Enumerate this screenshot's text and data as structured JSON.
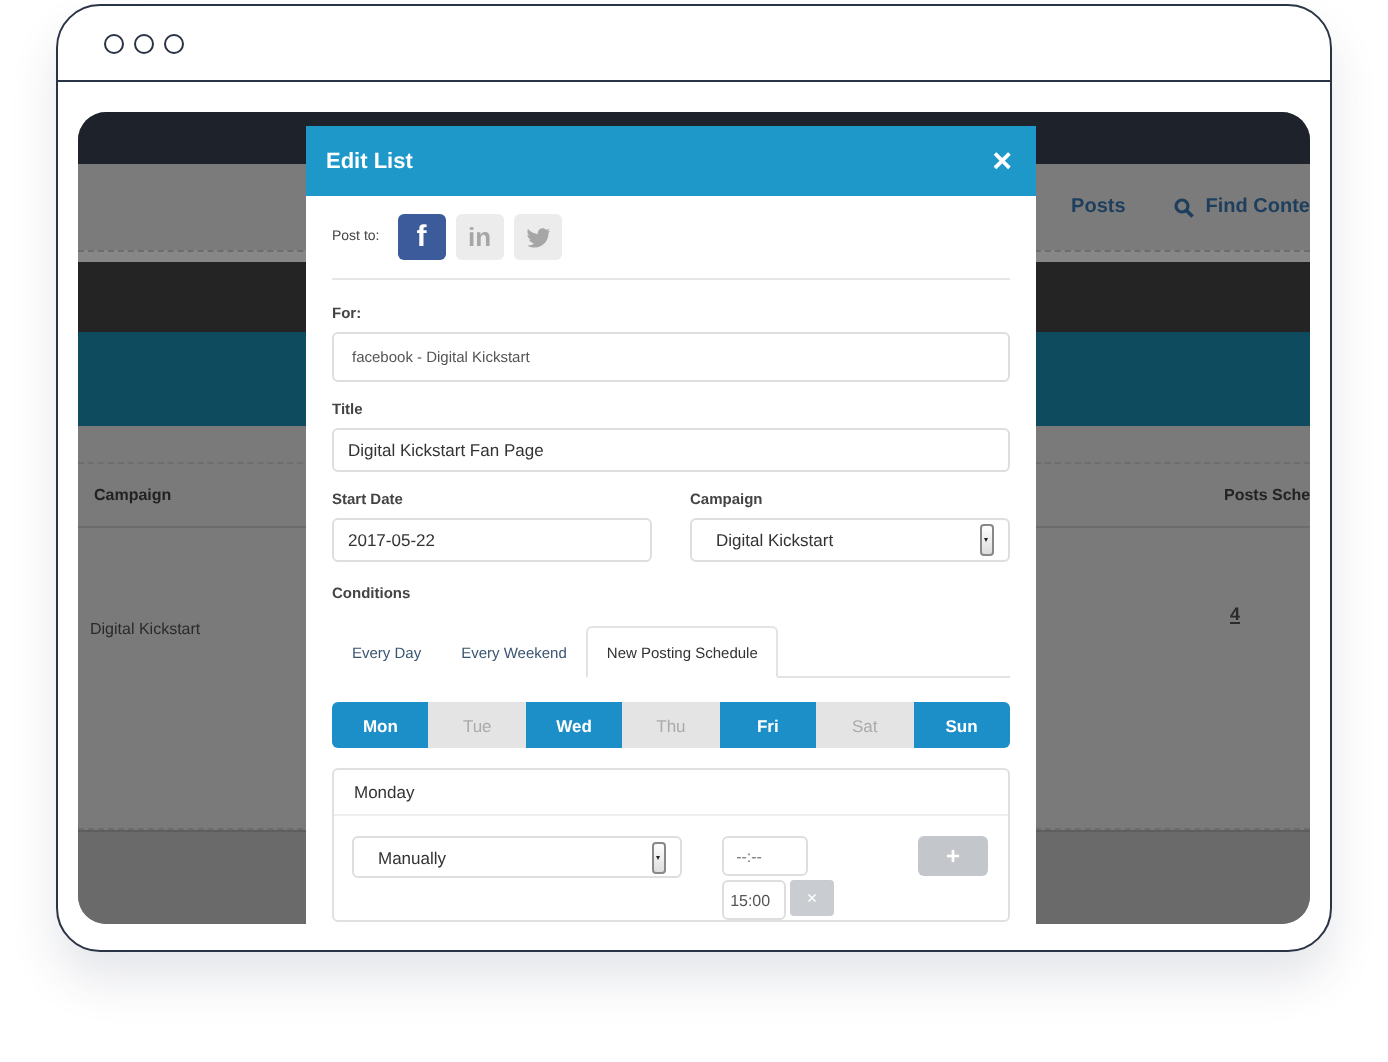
{
  "background_page": {
    "nav_items": [
      {
        "label": "Posts",
        "kind": "link"
      },
      {
        "label": "Find Conte",
        "kind": "search"
      }
    ],
    "table": {
      "columns": [
        "Campaign",
        "Posts Sche"
      ],
      "rows": [
        {
          "campaign": "Digital Kickstart",
          "posts": "4"
        }
      ]
    }
  },
  "dialog": {
    "title": "Edit List",
    "close": "×",
    "post_to": {
      "label": "Post to:",
      "networks": [
        {
          "kind": "facebook",
          "glyph": "f",
          "selected": true
        },
        {
          "kind": "linkedin",
          "glyph": "in",
          "selected": false
        },
        {
          "kind": "twitter",
          "selected": false
        }
      ]
    },
    "for": {
      "label": "For:",
      "value": "facebook - Digital Kickstart"
    },
    "title_field": {
      "label": "Title",
      "value": "Digital Kickstart Fan Page"
    },
    "start_date": {
      "label": "Start Date",
      "value": "2017-05-22"
    },
    "campaign": {
      "label": "Campaign",
      "value": "Digital Kickstart"
    },
    "conditions": {
      "label": "Conditions",
      "tabs": [
        {
          "label": "Every Day",
          "selected": false
        },
        {
          "label": "Every Weekend",
          "selected": false
        },
        {
          "label": "New Posting Schedule",
          "selected": true
        }
      ],
      "days": [
        {
          "label": "Mon",
          "selected": true
        },
        {
          "label": "Tue",
          "selected": false
        },
        {
          "label": "Wed",
          "selected": true
        },
        {
          "label": "Thu",
          "selected": false
        },
        {
          "label": "Fri",
          "selected": true
        },
        {
          "label": "Sat",
          "selected": false
        },
        {
          "label": "Sun",
          "selected": true
        }
      ],
      "panel": {
        "title": "Monday",
        "mode": "Manually",
        "time_placeholder": "--:--",
        "add": "+",
        "times": [
          {
            "value": "15:00",
            "remove": "×"
          }
        ]
      }
    }
  }
}
